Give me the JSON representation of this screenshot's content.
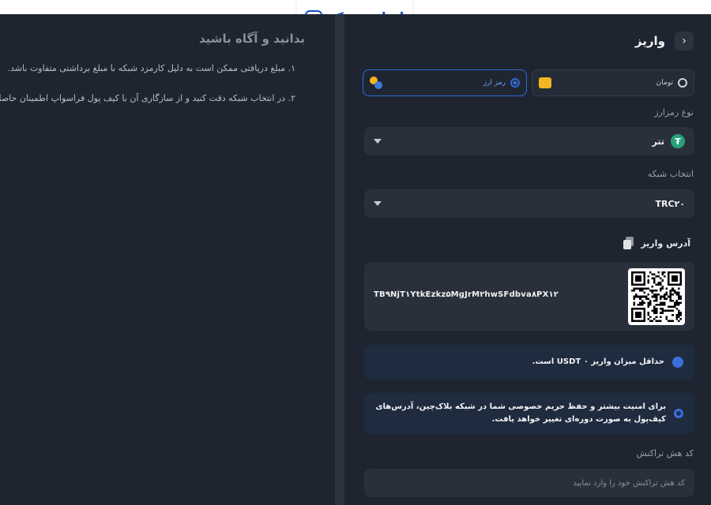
{
  "brand": {
    "logo_text": "ایران بروکر"
  },
  "left_panel": {
    "title": "بدانید و آگاه باشید",
    "notes": [
      "۱. مبلغ دریافتی ممکن است به دلیل کارمزد شبکه با مبلغ برداشتی متفاوت باشد.",
      "۲. در انتخاب شبکه دقت کنید و از سازگاری آن با کیف پول فراسواپ اطمینان حاصل کنید."
    ]
  },
  "header": {
    "title": "واریز",
    "back_icon": "chevron-right-icon"
  },
  "tabs": [
    {
      "label": "تومان",
      "selected": false,
      "icon": "toman-coin-icon"
    },
    {
      "label": "رمز ارز",
      "selected": true,
      "icon": "crypto-coins-icon"
    }
  ],
  "crypto_type": {
    "label": "نوع رمزارز",
    "value": "تتر",
    "icon": "tether-icon",
    "icon_glyph": "₮"
  },
  "network": {
    "label": "انتخاب شبکه",
    "value": "TRC۲۰"
  },
  "address": {
    "label": "آدرس واریز",
    "value": "TB۹NjT۱YtkEzkz۵MgJrM۲hwSFdbva۸PX۱۲"
  },
  "notices": [
    {
      "text": "حداقل میزان واریز ۰ USDT است.",
      "icon": "drop-icon"
    },
    {
      "text": "برای امنیت بیشتر و حفظ حریم خصوصی شما در شبکه بلاک‌چین، آدرس‌های کیف‌پول به صورت دوره‌ای تغییر خواهد یافت.",
      "icon": "info-dot-icon"
    }
  ],
  "tx_hash": {
    "label": "کد هش تراکنش",
    "placeholder": "کد هش تراکنش خود را وارد نمایید"
  },
  "colors": {
    "accent": "#2f6bd6",
    "tether": "#26a17b",
    "bg": "#1f2530",
    "field": "#2a303b"
  }
}
